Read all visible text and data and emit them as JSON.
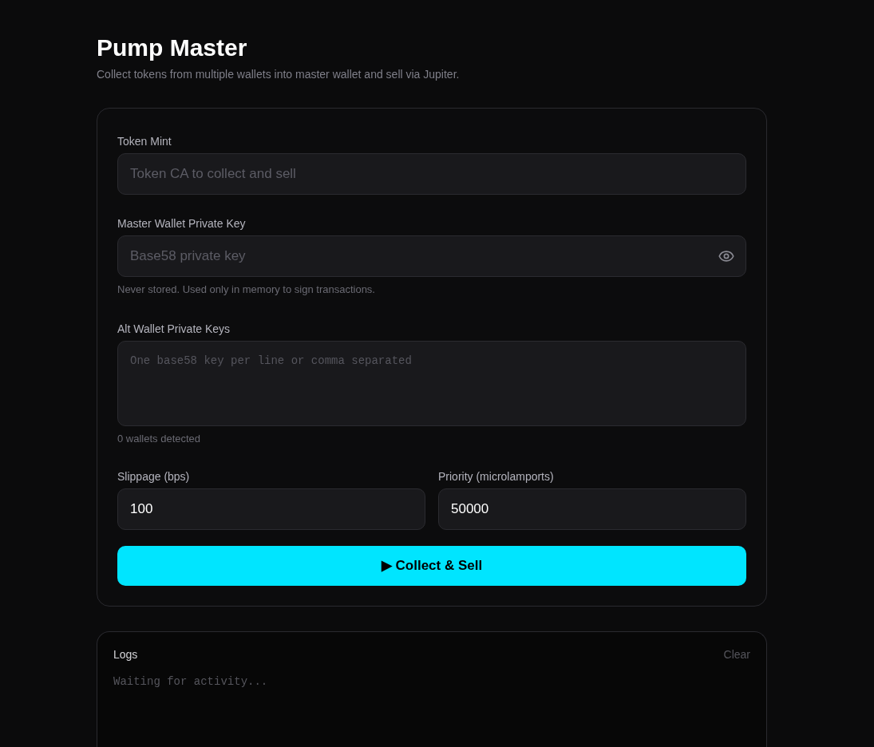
{
  "header": {
    "title": "Pump Master",
    "subtitle": "Collect tokens from multiple wallets into master wallet and sell via Jupiter."
  },
  "form": {
    "fields": [
      {
        "kind": "text",
        "label": "Token Mint",
        "placeholder": "Token CA to collect and sell"
      },
      {
        "kind": "secret",
        "label": "Master Wallet Private Key",
        "placeholder": "Base58 private key",
        "hint": "Never stored. Used only in memory to sign transactions."
      },
      {
        "kind": "multiline",
        "label": "Alt Wallet Private Keys",
        "placeholder": "One base58 key per line or comma separated",
        "hint": "0 wallets detected"
      }
    ],
    "settings": [
      {
        "label": "Slippage (bps)",
        "value": "100"
      },
      {
        "label": "Priority (microlamports)",
        "value": "50000"
      }
    ],
    "submit_button": "▶ Collect & Sell"
  },
  "logs": {
    "title": "Logs",
    "clear_button": "Clear",
    "lines": [
      "Waiting for activity..."
    ]
  }
}
